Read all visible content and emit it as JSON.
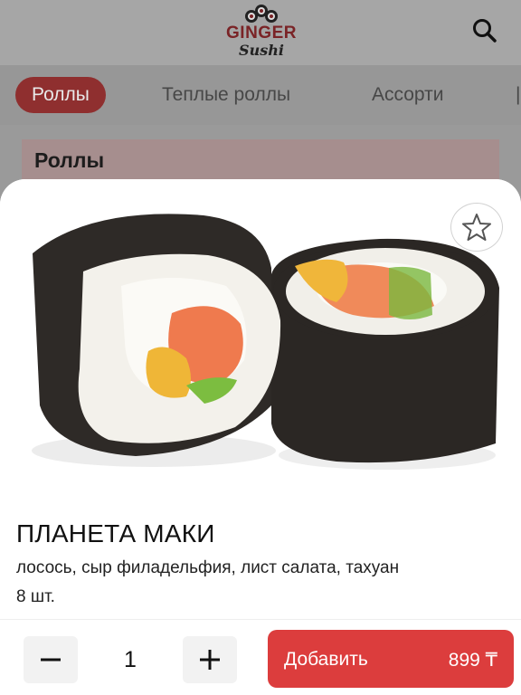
{
  "app": {
    "logo_line1": "GINGER",
    "logo_line2": "Sushi"
  },
  "categories": [
    {
      "label": "Роллы",
      "active": true
    },
    {
      "label": "Теплые роллы",
      "active": false
    },
    {
      "label": "Ассорти",
      "active": false
    }
  ],
  "section": {
    "title": "Роллы"
  },
  "product": {
    "name": "ПЛАНЕТА МАКИ",
    "description": "лосось, сыр филадельфия, лист салата, тахуан",
    "portion": "8 шт.",
    "quantity": "1",
    "add_label": "Добавить",
    "price": "899 ₸"
  },
  "icons": {
    "search": "search-icon",
    "favorite": "star-outline-icon",
    "minus": "minus-icon",
    "plus": "plus-icon"
  },
  "colors": {
    "accent": "#dc3d3d",
    "active_chip": "#c03a3a"
  }
}
